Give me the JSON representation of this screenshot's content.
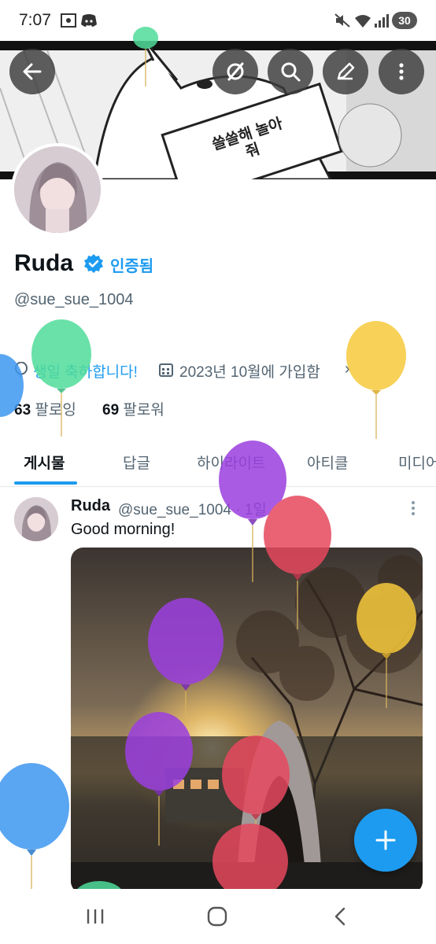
{
  "status_bar": {
    "time": "7:07",
    "battery": "30"
  },
  "banner": {
    "manga_text": "쓸쓸해 놀아줘"
  },
  "profile": {
    "name": "Ruda",
    "verified_label": "인증됨",
    "handle": "@sue_sue_1004",
    "birthday": "생일 축하합니다!",
    "joined": "2023년 10월에 가입함",
    "following_count": "63",
    "following_label": "팔로잉",
    "followers_count": "69",
    "followers_label": "팔로워"
  },
  "tabs": [
    {
      "label": "게시물"
    },
    {
      "label": "답글"
    },
    {
      "label": "하이라이트"
    },
    {
      "label": "아티클"
    },
    {
      "label": "미디어"
    }
  ],
  "post": {
    "author": "Ruda",
    "meta": "@sue_sue_1004 · 1일",
    "text": "Good morning!"
  },
  "colors": {
    "accent": "#1d9bf0",
    "header_button": "#3c3c3c"
  },
  "icons": [
    "back-arrow-icon",
    "incognito-icon",
    "search-icon",
    "edit-icon",
    "more-vertical-icon",
    "balloon-icon",
    "calendar-icon",
    "plus-icon",
    "recent-apps-icon",
    "home-icon",
    "back-icon"
  ]
}
